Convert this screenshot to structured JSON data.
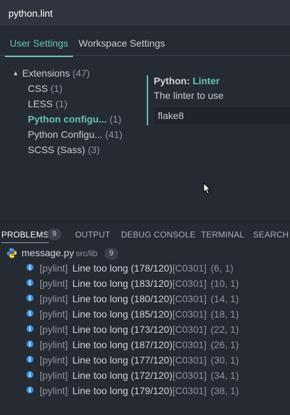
{
  "search": {
    "value": "python.lint"
  },
  "tabs": [
    {
      "label": "User Settings"
    },
    {
      "label": "Workspace Settings"
    }
  ],
  "tree": {
    "group_label": "Extensions",
    "group_count": "(47)",
    "items": [
      {
        "name": "CSS",
        "count": "(1)"
      },
      {
        "name": "LESS",
        "count": "(1)"
      },
      {
        "name": "Python configu...",
        "count": "(1)"
      },
      {
        "name": "Python Configu...",
        "count": "(41)"
      },
      {
        "name": "SCSS (Sass)",
        "count": "(3)"
      }
    ]
  },
  "setting": {
    "category": "Python:",
    "key": "Linter",
    "description": "The linter to use",
    "value": "flake8"
  },
  "panel": {
    "tabs": [
      {
        "label": "PROBLEMS"
      },
      {
        "label": "OUTPUT"
      },
      {
        "label": "DEBUG CONSOLE"
      },
      {
        "label": "TERMINAL"
      },
      {
        "label": "SEARCH"
      }
    ],
    "problems_count": "9",
    "file": {
      "name": "message.py",
      "path": "src/lib",
      "count": "9"
    },
    "problems": [
      {
        "source": "[pylint]",
        "message": "Line too long (178/120)",
        "code": "[C0301]",
        "position": "(6, 1)"
      },
      {
        "source": "[pylint]",
        "message": "Line too long (183/120)",
        "code": "[C0301]",
        "position": "(10, 1)"
      },
      {
        "source": "[pylint]",
        "message": "Line too long (180/120)",
        "code": "[C0301]",
        "position": "(14, 1)"
      },
      {
        "source": "[pylint]",
        "message": "Line too long (185/120)",
        "code": "[C0301]",
        "position": "(18, 1)"
      },
      {
        "source": "[pylint]",
        "message": "Line too long (173/120)",
        "code": "[C0301]",
        "position": "(22, 1)"
      },
      {
        "source": "[pylint]",
        "message": "Line too long (187/120)",
        "code": "[C0301]",
        "position": "(26, 1)"
      },
      {
        "source": "[pylint]",
        "message": "Line too long (177/120)",
        "code": "[C0301]",
        "position": "(30, 1)"
      },
      {
        "source": "[pylint]",
        "message": "Line too long (172/120)",
        "code": "[C0301]",
        "position": "(34, 1)"
      },
      {
        "source": "[pylint]",
        "message": "Line too long (179/120)",
        "code": "[C0301]",
        "position": "(38, 1)"
      }
    ]
  },
  "colors": {
    "background": "#262a33",
    "accent": "#68c3b3",
    "info": "#3d8fe0"
  },
  "icons": {
    "tree_caret": "triangle-down-icon",
    "file": "python-icon",
    "problem": "info-icon"
  }
}
